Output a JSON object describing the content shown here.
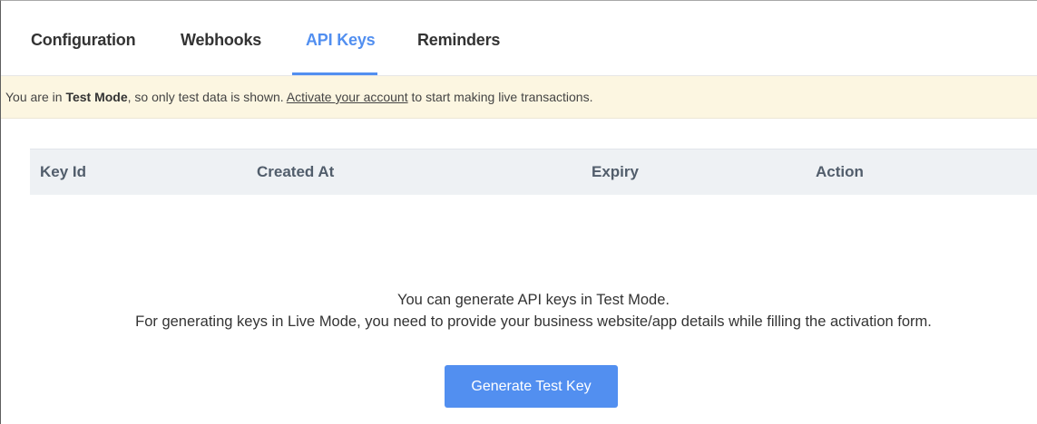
{
  "tabs": [
    {
      "label": "Configuration",
      "active": false
    },
    {
      "label": "Webhooks",
      "active": false
    },
    {
      "label": "API Keys",
      "active": true
    },
    {
      "label": "Reminders",
      "active": false
    }
  ],
  "banner": {
    "prefix": "You are in ",
    "mode": "Test Mode",
    "middle": ", so only test data is shown. ",
    "link": "Activate your account",
    "suffix": " to start making live transactions."
  },
  "table": {
    "columns": [
      "Key Id",
      "Created At",
      "Expiry",
      "Action"
    ],
    "rows": []
  },
  "empty_state": {
    "line1": "You can generate API keys in Test Mode.",
    "line2": "For generating keys in Live Mode, you need to provide your business website/app details while filling the activation form."
  },
  "generate_button": {
    "label": "Generate Test Key"
  },
  "colors": {
    "accent": "#528ff0",
    "banner_bg": "#fcf6e1",
    "table_header_bg": "#eef1f4"
  }
}
